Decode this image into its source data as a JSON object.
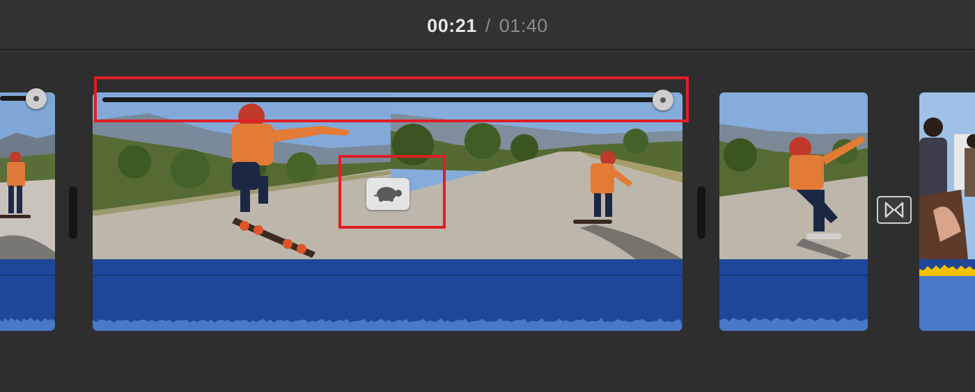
{
  "timecode": {
    "current": "00:21",
    "separator": "/",
    "total": "01:40"
  },
  "clips": [
    {
      "id": "clip-left-partial",
      "has_speed_slider": true
    },
    {
      "id": "clip-selected-slowmo",
      "has_speed_slider": true,
      "speed_indicator": "turtle-icon"
    },
    {
      "id": "clip-third"
    },
    {
      "id": "clip-right-partial",
      "audio_level_color": "#f2c200"
    }
  ],
  "colors": {
    "highlight": "#e01e26",
    "audio_track": "#1f4799",
    "waveform": "#4a78c8",
    "audio_peak": "#f2c200"
  },
  "icons": {
    "speed_indicator": "turtle-icon",
    "transition": "transition-icon"
  }
}
